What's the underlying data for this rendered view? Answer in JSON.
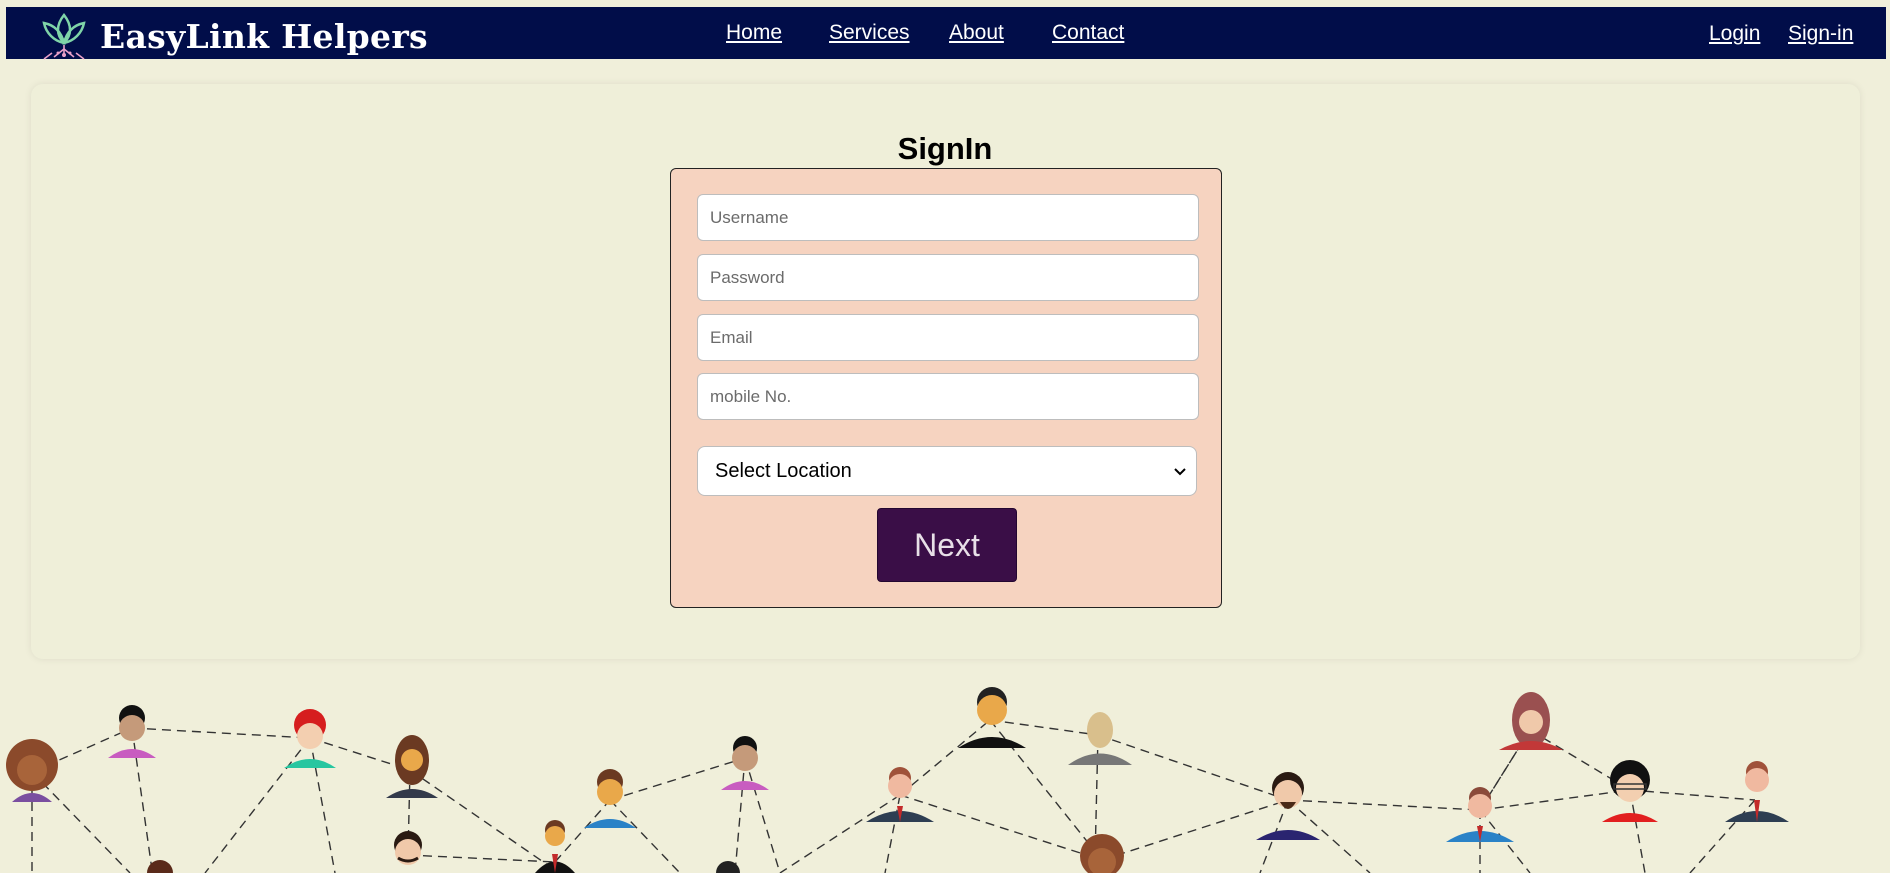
{
  "header": {
    "brand_name": "EasyLink Helpers",
    "logo_icon": "lotus-icon",
    "nav": [
      "Home",
      "Services",
      "About",
      "Contact"
    ],
    "auth": [
      "Login",
      "Sign-in"
    ]
  },
  "signin": {
    "title": "SignIn",
    "username_placeholder": "Username",
    "password_placeholder": "Password",
    "email_placeholder": "Email",
    "mobile_placeholder": "mobile No.",
    "location_selected": "Select Location",
    "next_label": "Next"
  },
  "colors": {
    "navbar": "#010d49",
    "page_background": "#f0efda",
    "form_background": "#f6d3c0",
    "next_button": "#3a0e47"
  },
  "illustration": {
    "description_icon": "people-network-icon"
  }
}
